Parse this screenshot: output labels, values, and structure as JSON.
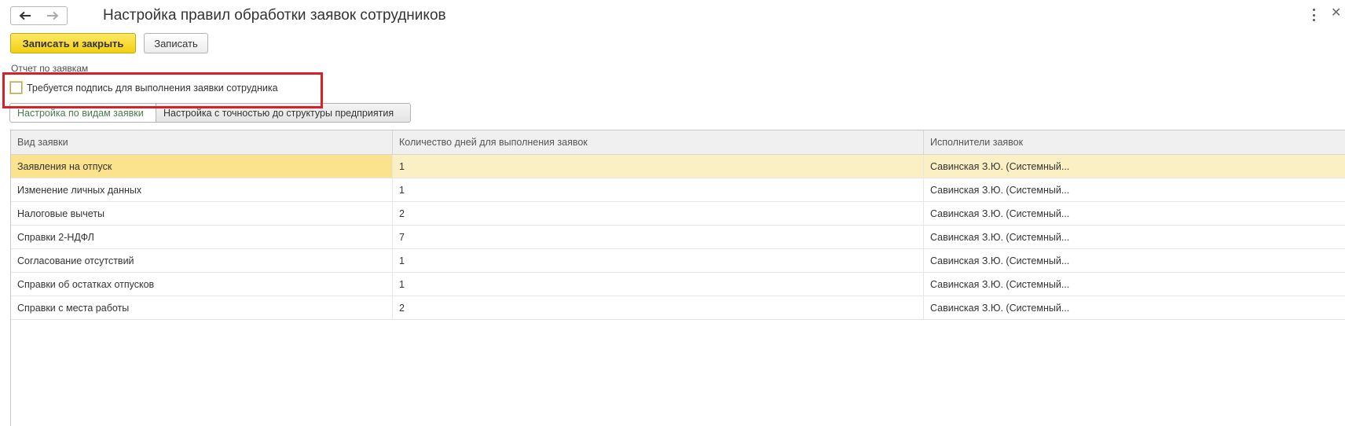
{
  "window": {
    "title": "Настройка правил обработки заявок сотрудников"
  },
  "toolbar": {
    "save_close_label": "Записать и закрыть",
    "save_label": "Записать"
  },
  "form": {
    "report_link": "Отчет по заявкам",
    "signature_checkbox": {
      "label": "Требуется подпись для выполнения заявки сотрудника",
      "checked": false
    }
  },
  "tabs": [
    {
      "label": "Настройка по видам заявки",
      "active": true
    },
    {
      "label": "Настройка с точностью до структуры предприятия",
      "active": false
    }
  ],
  "table": {
    "headers": [
      "Вид заявки",
      "Количество дней для выполнения заявок",
      "Исполнители заявок"
    ],
    "rows": [
      {
        "type": "Заявления на отпуск",
        "days": "1",
        "executors": "Савинская З.Ю. (Системный..."
      },
      {
        "type": "Изменение личных данных",
        "days": "1",
        "executors": "Савинская З.Ю. (Системный..."
      },
      {
        "type": "Налоговые вычеты",
        "days": "2",
        "executors": "Савинская З.Ю. (Системный..."
      },
      {
        "type": "Справки 2-НДФЛ",
        "days": "7",
        "executors": "Савинская З.Ю. (Системный..."
      },
      {
        "type": "Согласование отсутствий",
        "days": "1",
        "executors": "Савинская З.Ю. (Системный..."
      },
      {
        "type": "Справки об остатках отпусков",
        "days": "1",
        "executors": "Савинская З.Ю. (Системный..."
      },
      {
        "type": "Справки с места работы",
        "days": "2",
        "executors": "Савинская З.Ю. (Системный..."
      }
    ],
    "selected_row": 0
  },
  "colors": {
    "primary_button": "#f2cf12",
    "highlight_box": "#d72027",
    "selected_row": "#fbf0c4",
    "selected_cell": "#fbe38d",
    "active_tab_text": "#4a7b4e"
  },
  "icons": {
    "back": "arrow-left-icon",
    "forward": "arrow-right-icon",
    "more": "more-vertical-icon",
    "close": "close-icon"
  }
}
